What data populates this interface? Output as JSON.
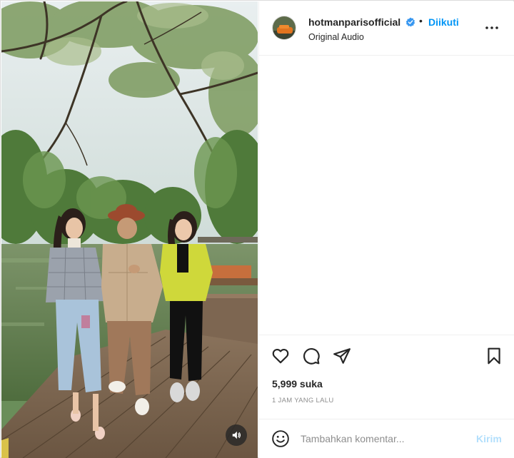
{
  "post": {
    "username": "hotmanparisofficial",
    "dot": "•",
    "follow_label": "Diikuti",
    "audio_label": "Original Audio",
    "likes": "5,999 suka",
    "time": "1 JAM YANG LALU",
    "comment_placeholder": "Tambahkan komentar...",
    "post_label": "Kirim"
  },
  "icons": {
    "verified": "verified-badge-icon",
    "more": "more-options-icon",
    "like": "heart-icon",
    "comment": "comment-icon",
    "share": "send-icon",
    "save": "bookmark-icon",
    "emoji": "emoji-icon",
    "sound": "speaker-icon"
  },
  "colors": {
    "accent": "#0095f6",
    "verified": "#3897f0",
    "post_disabled": "#b2dffc",
    "muted_text": "#8e8e8e"
  }
}
